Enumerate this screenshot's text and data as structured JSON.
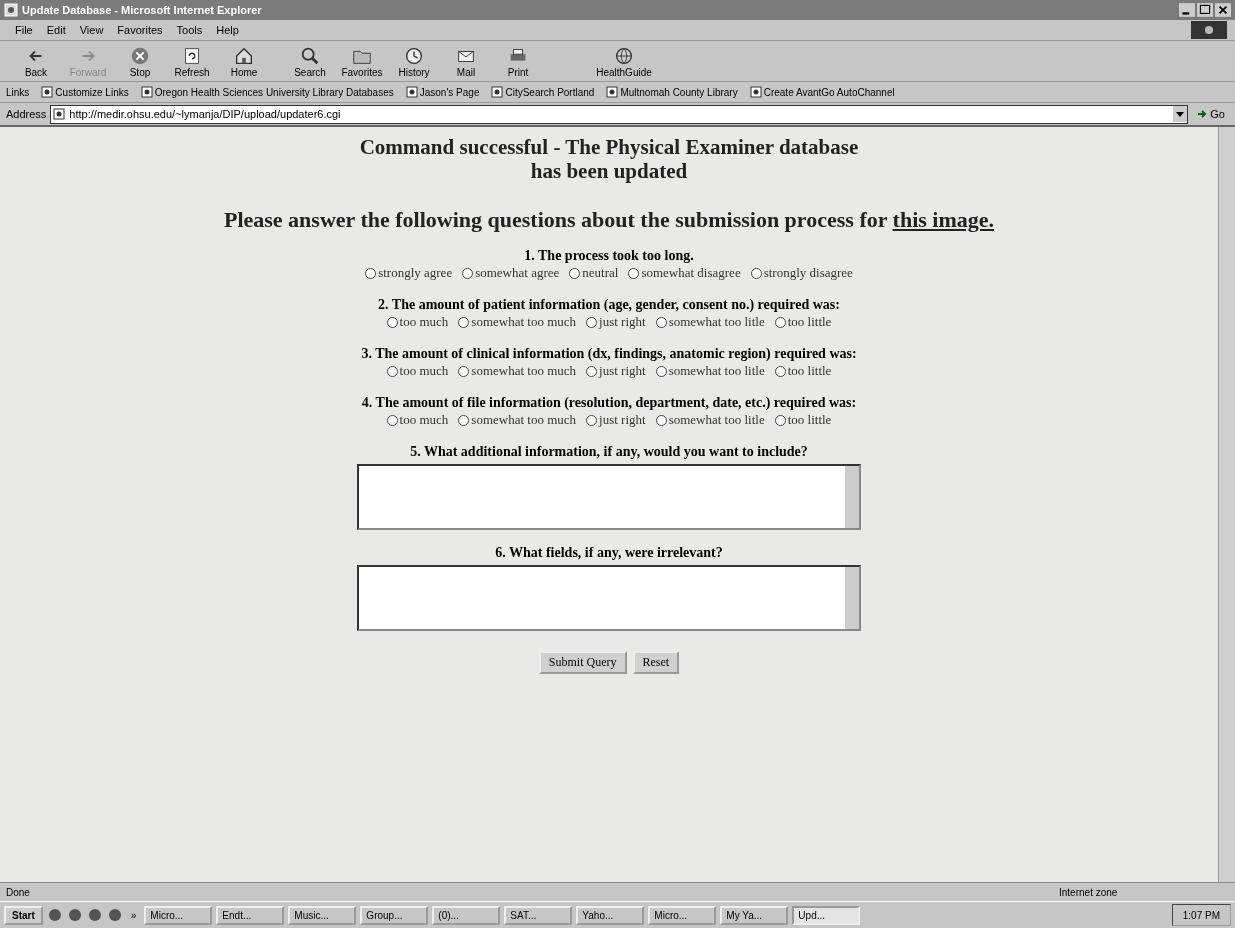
{
  "window": {
    "title": "Update Database - Microsoft Internet Explorer"
  },
  "menu": [
    "File",
    "Edit",
    "View",
    "Favorites",
    "Tools",
    "Help"
  ],
  "toolbar": [
    {
      "label": "Back",
      "disabled": false
    },
    {
      "label": "Forward",
      "disabled": true
    },
    {
      "label": "Stop",
      "disabled": false
    },
    {
      "label": "Refresh",
      "disabled": false
    },
    {
      "label": "Home",
      "disabled": false
    },
    {
      "label": "Search",
      "disabled": false
    },
    {
      "label": "Favorites",
      "disabled": false
    },
    {
      "label": "History",
      "disabled": false
    },
    {
      "label": "Mail",
      "disabled": false
    },
    {
      "label": "Print",
      "disabled": false
    },
    {
      "label": "HealthGuide",
      "disabled": false
    }
  ],
  "links": {
    "label": "Links",
    "items": [
      "Customize Links",
      "Oregon Health Sciences University Library Databases",
      "Jason's Page",
      "CitySearch Portland",
      "Multnomah County Library",
      "Create AvantGo AutoChannel"
    ]
  },
  "address": {
    "label": "Address",
    "value": "http://medir.ohsu.edu/~lymanja/DIP/upload/updater6.cgi",
    "go": "Go"
  },
  "page": {
    "heading": [
      "Command successful - The Physical Examiner database",
      "has been updated"
    ],
    "prompt": "Please answer the following questions about the submission process for",
    "prompt_link": "this image.",
    "questions": [
      {
        "kind": "radio",
        "label": "1. The process took too long.",
        "options": [
          {
            "label": "strongly agree",
            "selected": false
          },
          {
            "label": "somewhat agree",
            "selected": false
          },
          {
            "label": "neutral",
            "selected": false
          },
          {
            "label": "somewhat disagree",
            "selected": false
          },
          {
            "label": "strongly disagree",
            "selected": false
          }
        ]
      },
      {
        "kind": "radio",
        "label": "2. The amount of patient information (age, gender, consent no.) required was:",
        "options": [
          {
            "label": "too much",
            "selected": false
          },
          {
            "label": "somewhat too much",
            "selected": false
          },
          {
            "label": "just right",
            "selected": false
          },
          {
            "label": "somewhat too litle",
            "selected": false
          },
          {
            "label": "too little",
            "selected": false
          }
        ]
      },
      {
        "kind": "radio",
        "label": "3. The amount of clinical information (dx, findings, anatomic region) required was:",
        "options": [
          {
            "label": "too much",
            "selected": false
          },
          {
            "label": "somewhat too much",
            "selected": false
          },
          {
            "label": "just right",
            "selected": false
          },
          {
            "label": "somewhat too litle",
            "selected": false
          },
          {
            "label": "too little",
            "selected": false
          }
        ]
      },
      {
        "kind": "radio",
        "label": "4. The amount of file information (resolution, department, date, etc.) required was:",
        "options": [
          {
            "label": "too much",
            "selected": false
          },
          {
            "label": "somewhat too much",
            "selected": false
          },
          {
            "label": "just right",
            "selected": false
          },
          {
            "label": "somewhat too litle",
            "selected": false
          },
          {
            "label": "too little",
            "selected": false
          }
        ]
      },
      {
        "kind": "text",
        "label": "5. What additional information, if any, would you want to include?"
      },
      {
        "kind": "text",
        "label": "6. What fields, if any, were irrelevant?"
      }
    ],
    "buttons": [
      "Submit Query",
      "Reset"
    ]
  },
  "status_bar": {
    "text": "Done",
    "zone": "Internet zone"
  },
  "taskbar": {
    "start": "Start",
    "more": "»",
    "tasks": [
      {
        "label": "Micro...",
        "selected": false
      },
      {
        "label": "Endt...",
        "selected": false
      },
      {
        "label": "Music...",
        "selected": false
      },
      {
        "label": "Group...",
        "selected": false
      },
      {
        "label": "(0)...",
        "selected": false
      },
      {
        "label": "SAT...",
        "selected": false
      },
      {
        "label": "Yaho...",
        "selected": false
      },
      {
        "label": "Micro...",
        "selected": false
      },
      {
        "label": "My Ya...",
        "selected": false
      },
      {
        "label": "Upd...",
        "selected": true
      }
    ],
    "clock": "1:07 PM"
  }
}
